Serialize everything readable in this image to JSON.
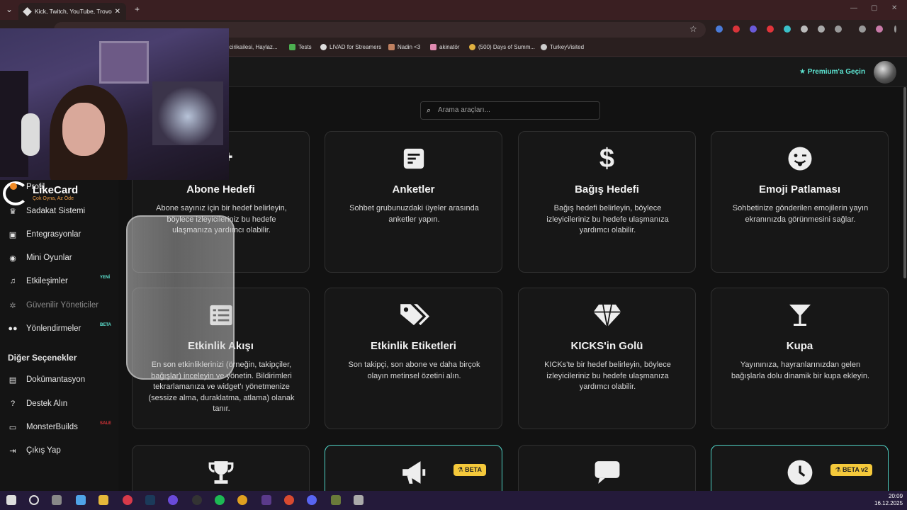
{
  "browser": {
    "tab_title": "Kick, Twitch, YouTube, Trovo ve",
    "new_tab": "+",
    "bookmarks": [
      "ilcirikailesi, Haylaz...",
      "Tests",
      "LIVAD for Streamers",
      "Nadin <3",
      "akinatör",
      "(500) Days of Summ...",
      "TurkeyVisited"
    ]
  },
  "header": {
    "premium_label": "Premium'a Geçin"
  },
  "search": {
    "placeholder": "Arama araçları..."
  },
  "overlay": {
    "brand_name": "LikeCard",
    "brand_tagline": "Çok Oyna, Az Öde"
  },
  "sidebar": {
    "items": [
      {
        "label": "Profil",
        "icon": "user-icon"
      },
      {
        "label": "Sadakat Sistemi",
        "icon": "trophy-icon"
      },
      {
        "label": "Entegrasyonlar",
        "icon": "plug-icon"
      },
      {
        "label": "Mini Oyunlar",
        "icon": "gamepad-icon"
      },
      {
        "label": "Etkileşimler",
        "icon": "music-icon",
        "badge": "YENİ"
      },
      {
        "label": "Güvenilir Yöneticiler",
        "icon": "gear-icon",
        "disabled": true
      },
      {
        "label": "Yönlendirmeler",
        "icon": "users-icon",
        "badge": "BETA"
      }
    ],
    "section_title": "Diğer Seçenekler",
    "other_items": [
      {
        "label": "Dokümantasyon",
        "icon": "document-icon"
      },
      {
        "label": "Destek Alın",
        "icon": "help-icon"
      },
      {
        "label": "MonsterBuilds",
        "icon": "laptop-icon",
        "badge": "SALE"
      },
      {
        "label": "Çıkış Yap",
        "icon": "logout-icon"
      }
    ]
  },
  "cards": [
    {
      "title": "Abone Hedefi",
      "desc": "Abone sayınız için bir hedef belirleyin, böylece izleyicileriniz bu hedefe ulaşmanıza yardımcı olabilir.",
      "icon": "user-plus-icon"
    },
    {
      "title": "Anketler",
      "desc": "Sohbet grubunuzdaki üyeler arasında anketler yapın.",
      "icon": "poll-icon"
    },
    {
      "title": "Bağış Hedefi",
      "desc": "Bağış hedefi belirleyin, böylece izleyicileriniz bu hedefe ulaşmanıza yardımcı olabilir.",
      "icon": "dollar-icon"
    },
    {
      "title": "Emoji Patlaması",
      "desc": "Sohbetinize gönderilen emojilerin yayın ekranınızda görünmesini sağlar.",
      "icon": "emoji-icon"
    },
    {
      "title": "Etkinlik Akışı",
      "desc": "En son etkinliklerinizi (örneğin, takipçiler, bağışlar) inceleyin ve yönetin. Bildirimleri tekrarlamanıza ve widget'ı yönetmenize (sessize alma, duraklatma, atlama) olanak tanır.",
      "icon": "list-icon"
    },
    {
      "title": "Etkinlik Etiketleri",
      "desc": "Son takipçi, son abone ve daha birçok olayın metinsel özetini alın.",
      "icon": "tags-icon"
    },
    {
      "title": "KICKS'in Golü",
      "desc": "KICKs'te bir hedef belirleyin, böylece izleyicileriniz bu hedefe ulaşmanıza yardımcı olabilir.",
      "icon": "diamond-icon"
    },
    {
      "title": "Kupa",
      "desc": "Yayınınıza, hayranlarınızdan gelen bağışlarla dolu dinamik bir kupa ekleyin.",
      "icon": "cocktail-icon"
    },
    {
      "title": "",
      "desc": "",
      "icon": "trophy-icon"
    },
    {
      "title": "",
      "desc": "",
      "icon": "megaphone-icon",
      "badge": "BETA"
    },
    {
      "title": "",
      "desc": "",
      "icon": "comment-icon"
    },
    {
      "title": "",
      "desc": "",
      "icon": "clock-icon",
      "badge": "BETA v2"
    }
  ],
  "taskbar": {
    "time": "20:09",
    "date": "16.12.2025"
  },
  "colors": {
    "accent": "#5ee6d3",
    "beta_badge": "#f5c93b",
    "new_badge": "#5ee6d3",
    "titlebar": "#3a1f22",
    "taskbar": "#241a3a"
  }
}
